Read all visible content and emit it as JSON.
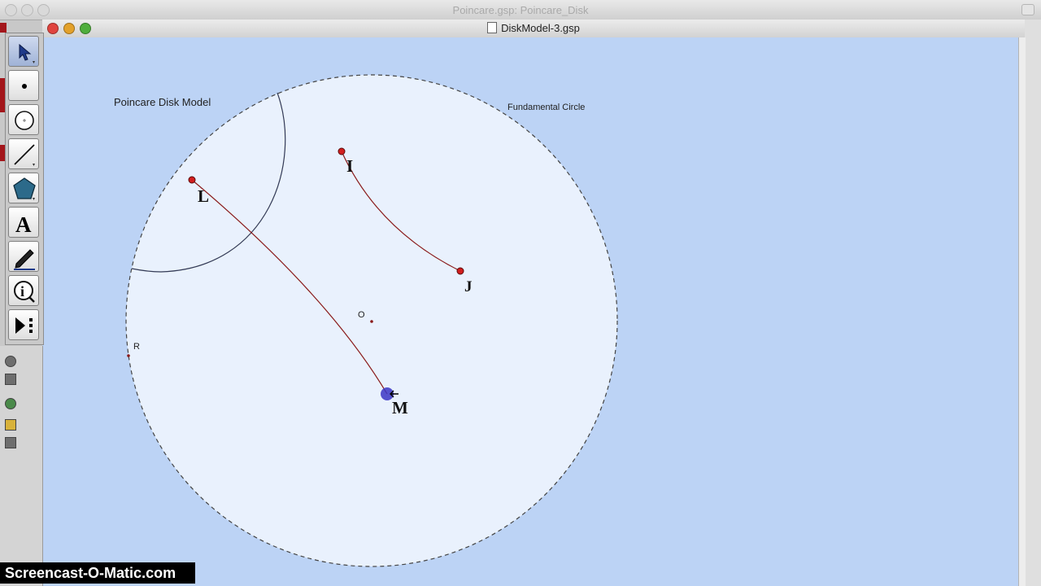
{
  "background_window": {
    "title": "Poincare.gsp: Poincare_Disk"
  },
  "document_window": {
    "title": "DiskModel-3.gsp"
  },
  "toolbox": {
    "tools": [
      {
        "name": "arrow-tool",
        "icon": "arrow-select-icon",
        "active": true
      },
      {
        "name": "point-tool",
        "icon": "point-icon"
      },
      {
        "name": "compass-tool",
        "icon": "compass-circle-icon"
      },
      {
        "name": "straightedge-tool",
        "icon": "line-segment-icon"
      },
      {
        "name": "polygon-tool",
        "icon": "pentagon-icon"
      },
      {
        "name": "text-tool",
        "icon": "text-A-icon",
        "label": "A"
      },
      {
        "name": "marker-tool",
        "icon": "marker-pen-icon"
      },
      {
        "name": "information-tool",
        "icon": "info-icon",
        "label": "i"
      },
      {
        "name": "custom-tool",
        "icon": "custom-tool-icon"
      }
    ]
  },
  "sketch": {
    "labels": {
      "model": "Poincare Disk Model",
      "circle": "Fundamental Circle",
      "center": "O",
      "radius_point": "R",
      "I": "I",
      "J": "J",
      "L": "L",
      "M": "M"
    },
    "colors": {
      "canvas": "#bcd3f5",
      "disk_fill": "#e9f1fd",
      "circle_stroke": "#444444",
      "geodesic": "#8a1a1a",
      "point": "#d21e1e",
      "selected_point": "#3a35c4"
    }
  },
  "watermark": "Screencast-O-Matic.com"
}
